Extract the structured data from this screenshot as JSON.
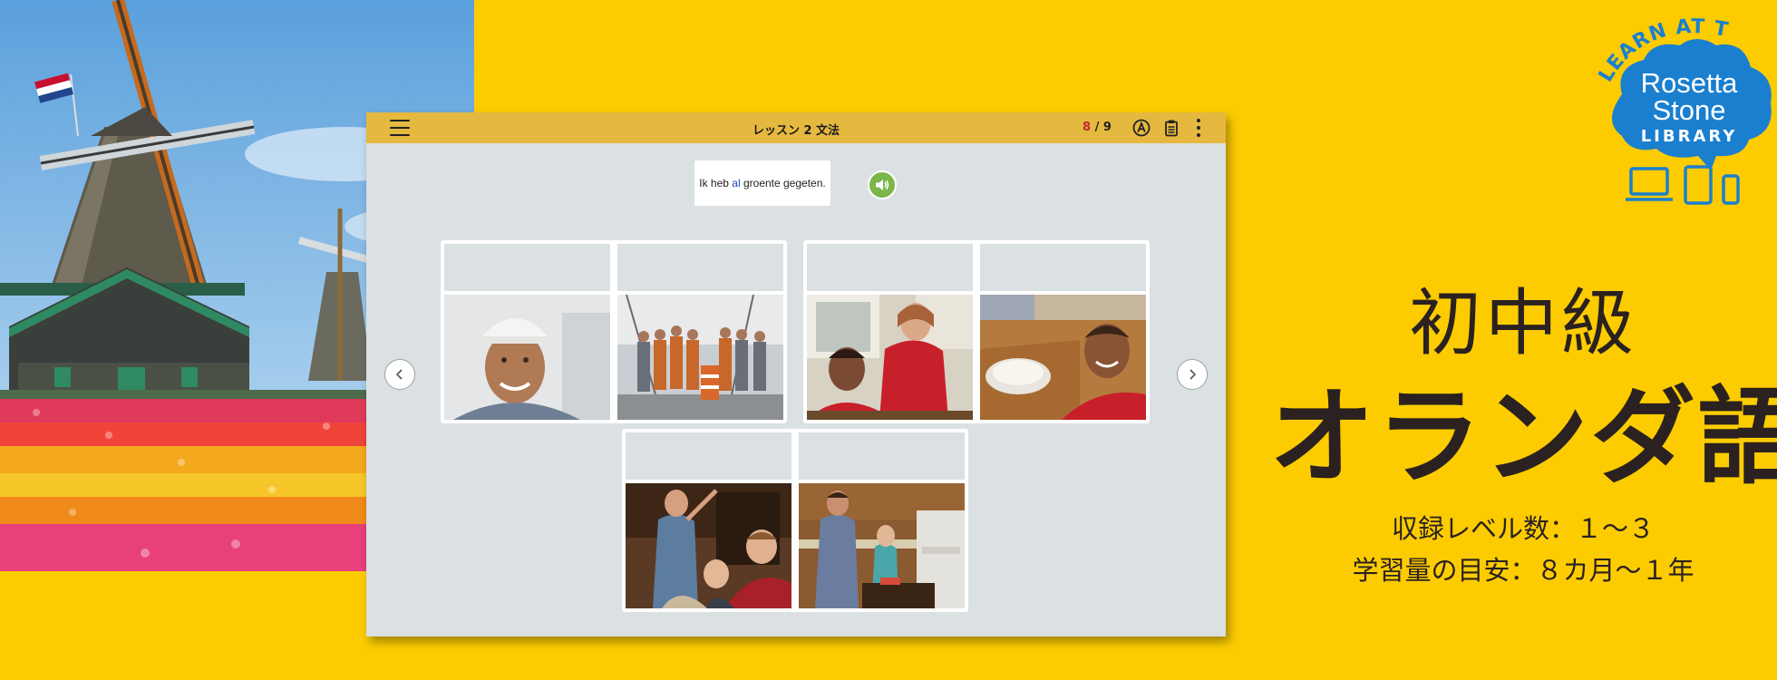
{
  "app": {
    "lesson_title": "レッスン 2 文法",
    "progress_current": "8",
    "progress_separator": " / ",
    "progress_total": "9",
    "prompt": {
      "before": "Ik heb ",
      "highlight": "al",
      "after": " groente gegeten."
    }
  },
  "promo": {
    "badge_arc": "LEARN AT THE",
    "badge_line1": "Rosetta",
    "badge_line2": "Stone",
    "badge_line3": "LIBRARY",
    "level": "初中級",
    "language": "オランダ語",
    "levels_label": "収録レベル数：１～３",
    "duration_label": "学習量の目安：８カ月～１年"
  },
  "colors": {
    "background": "#fccc00",
    "header": "#e5b940",
    "panel": "#dbe0e3",
    "audio": "#7ab648",
    "progress_current": "#c0282d",
    "badge": "#1a7fcf"
  },
  "icons": [
    "menu-icon",
    "answer-a-icon",
    "notes-icon",
    "kebab-icon",
    "speaker-icon",
    "chevron-left-icon",
    "chevron-right-icon"
  ]
}
